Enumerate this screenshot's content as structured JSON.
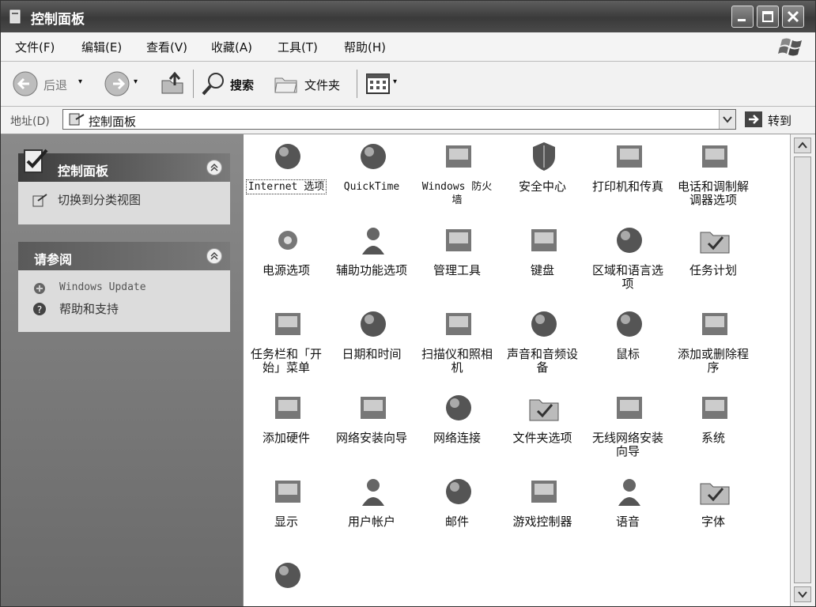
{
  "window": {
    "title": "控制面板",
    "buttons": [
      "minimize-button",
      "maximize-button",
      "close-button"
    ]
  },
  "menu": [
    "文件(F)",
    "编辑(E)",
    "查看(V)",
    "收藏(A)",
    "工具(T)",
    "帮助(H)"
  ],
  "toolbar": {
    "back": "后退",
    "search": "搜索",
    "folders": "文件夹"
  },
  "address": {
    "label": "地址(D)",
    "value": "控制面板",
    "go": "转到"
  },
  "sidebar": {
    "panel_title": "控制面板",
    "switch_view": "切换到分类视图",
    "see_also_title": "请参阅",
    "see_also": [
      "Windows Update",
      "帮助和支持"
    ]
  },
  "items": [
    {
      "label": "Internet 选项",
      "icon": "internet-options-icon"
    },
    {
      "label": "QuickTime",
      "icon": "quicktime-icon"
    },
    {
      "label": "Windows 防火墙",
      "icon": "firewall-icon"
    },
    {
      "label": "安全中心",
      "icon": "security-center-icon"
    },
    {
      "label": "打印机和传真",
      "icon": "printer-icon"
    },
    {
      "label": "电话和调制解调器选项",
      "icon": "phone-modem-icon"
    },
    {
      "label": "电源选项",
      "icon": "power-options-icon"
    },
    {
      "label": "辅助功能选项",
      "icon": "accessibility-icon"
    },
    {
      "label": "管理工具",
      "icon": "admin-tools-icon"
    },
    {
      "label": "键盘",
      "icon": "keyboard-icon"
    },
    {
      "label": "区域和语言选项",
      "icon": "globe-icon"
    },
    {
      "label": "任务计划",
      "icon": "scheduled-tasks-icon"
    },
    {
      "label": "任务栏和「开始」菜单",
      "icon": "taskbar-icon"
    },
    {
      "label": "日期和时间",
      "icon": "clock-icon"
    },
    {
      "label": "扫描仪和照相机",
      "icon": "scanner-icon"
    },
    {
      "label": "声音和音频设备",
      "icon": "speaker-icon"
    },
    {
      "label": "鼠标",
      "icon": "mouse-icon"
    },
    {
      "label": "添加或删除程序",
      "icon": "add-remove-programs-icon"
    },
    {
      "label": "添加硬件",
      "icon": "add-hardware-icon"
    },
    {
      "label": "网络安装向导",
      "icon": "network-wizard-icon"
    },
    {
      "label": "网络连接",
      "icon": "network-connections-icon"
    },
    {
      "label": "文件夹选项",
      "icon": "folder-options-icon"
    },
    {
      "label": "无线网络安装向导",
      "icon": "wireless-icon"
    },
    {
      "label": "系统",
      "icon": "system-icon"
    },
    {
      "label": "显示",
      "icon": "display-icon"
    },
    {
      "label": "用户帐户",
      "icon": "user-accounts-icon"
    },
    {
      "label": "邮件",
      "icon": "mail-icon"
    },
    {
      "label": "游戏控制器",
      "icon": "game-controller-icon"
    },
    {
      "label": "语音",
      "icon": "speech-icon"
    },
    {
      "label": "字体",
      "icon": "fonts-icon"
    },
    {
      "label": "",
      "icon": "partial-icon"
    }
  ]
}
